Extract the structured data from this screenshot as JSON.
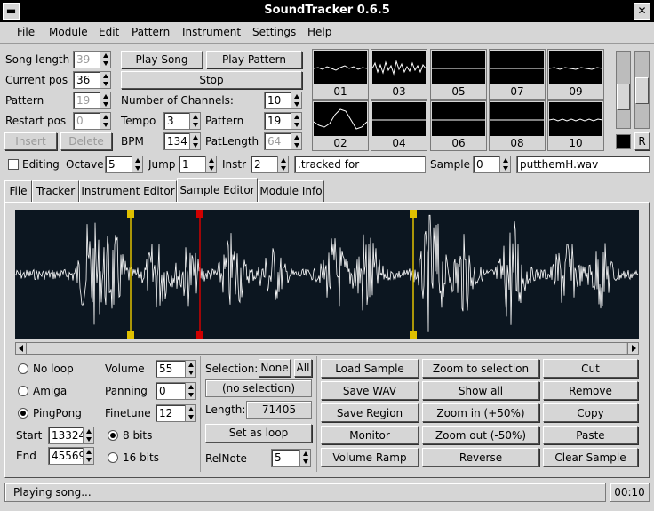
{
  "window": {
    "title": "SoundTracker 0.6.5"
  },
  "menu": [
    "File",
    "Module",
    "Edit",
    "Pattern",
    "Instrument",
    "Settings",
    "Help"
  ],
  "song": {
    "length_label": "Song length",
    "length": "39",
    "current_pos_label": "Current pos",
    "current_pos": "36",
    "pattern_label": "Pattern",
    "pattern": "19",
    "restart_label": "Restart pos",
    "restart": "0",
    "insert": "Insert",
    "delete": "Delete"
  },
  "playback": {
    "play_song": "Play Song",
    "play_pattern": "Play Pattern",
    "stop": "Stop",
    "channels_label": "Number of Channels:",
    "channels": "10",
    "tempo_label": "Tempo",
    "tempo": "3",
    "pattern_label": "Pattern",
    "pattern": "19",
    "bpm_label": "BPM",
    "bpm": "134",
    "patlength_label": "PatLength",
    "patlength": "64"
  },
  "scopes": [
    "01",
    "03",
    "05",
    "07",
    "09",
    "02",
    "04",
    "06",
    "08",
    "10"
  ],
  "mixer": {
    "r_label": "R"
  },
  "editbar": {
    "editing_label": "Editing",
    "octave_label": "Octave",
    "octave": "5",
    "jump_label": "Jump",
    "jump": "1",
    "instr_label": "Instr",
    "instr": "2",
    "instr_name": ".tracked for",
    "sample_label": "Sample",
    "sample": "0",
    "sample_name": "putthemH.wav"
  },
  "tabs": [
    "File",
    "Tracker",
    "Instrument Editor",
    "Sample Editor",
    "Module Info"
  ],
  "loop": {
    "no_loop": "No loop",
    "amiga": "Amiga",
    "pingpong": "PingPong",
    "selected": "PingPong",
    "start_label": "Start",
    "start": "13324",
    "end_label": "End",
    "end": "45569"
  },
  "sample_props": {
    "volume_label": "Volume",
    "volume": "55",
    "panning_label": "Panning",
    "panning": "0",
    "finetune_label": "Finetune",
    "finetune": "12",
    "bits8": "8 bits",
    "bits16": "16 bits",
    "bits_selected": "8 bits"
  },
  "selection": {
    "label": "Selection:",
    "none": "None",
    "all": "All",
    "status": "(no selection)",
    "length_label": "Length:",
    "length": "71405",
    "set_loop": "Set as loop",
    "relnote_label": "RelNote",
    "relnote": "5"
  },
  "actions": [
    [
      "Load Sample",
      "Zoom to selection",
      "Cut"
    ],
    [
      "Save WAV",
      "Show all",
      "Remove"
    ],
    [
      "Save Region",
      "Zoom in (+50%)",
      "Copy"
    ],
    [
      "Monitor",
      "Zoom out (-50%)",
      "Paste"
    ],
    [
      "Volume Ramp",
      "Reverse",
      "Clear Sample"
    ]
  ],
  "status": {
    "text": "Playing song...",
    "time": "00:10"
  },
  "colors": {
    "wave_bg": "#0c1620",
    "loop_marker": "#e0c000",
    "play_marker": "#d00000"
  }
}
